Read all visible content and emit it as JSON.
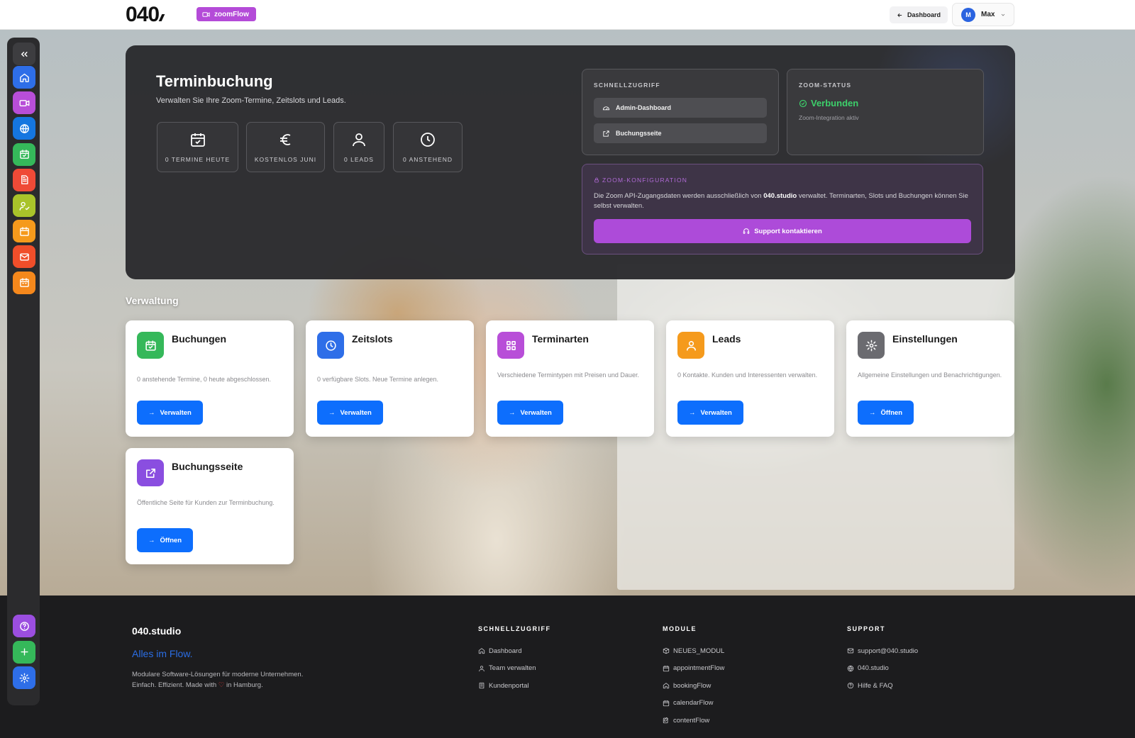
{
  "topbar": {
    "logo": "040",
    "module_label": "zoomFlow",
    "dashboard_label": "Dashboard",
    "user_initial": "M",
    "user_name": "Max"
  },
  "sidebar": {
    "collapse_icon": "chevrons-left-icon",
    "items": [
      {
        "name": "home-icon",
        "color": "#2e6ee8"
      },
      {
        "name": "video-icon",
        "color": "#b84ed8"
      },
      {
        "name": "globe-icon",
        "color": "#1576e0"
      },
      {
        "name": "calendar-check-icon",
        "color": "#35b85a"
      },
      {
        "name": "document-icon",
        "color": "#ef4a37"
      },
      {
        "name": "user-check-icon",
        "color": "#a9c32a"
      },
      {
        "name": "calendar-icon",
        "color": "#f59a1c"
      },
      {
        "name": "mail-icon",
        "color": "#f04e2a"
      },
      {
        "name": "calendar-alt-icon",
        "color": "#f5881c"
      }
    ],
    "bottom": [
      {
        "name": "help-icon",
        "color": "#9b4ee0"
      },
      {
        "name": "plus-icon",
        "color": "#35b85a"
      },
      {
        "name": "settings-icon",
        "color": "#2e6ee8"
      }
    ]
  },
  "hero": {
    "title": "Terminbuchung",
    "subtitle": "Verwalten Sie Ihre Zoom-Termine, Zeitslots und Leads.",
    "stats": [
      {
        "icon": "calendar-check-icon",
        "label": "0 TERMINE HEUTE"
      },
      {
        "icon": "euro-icon",
        "label": "KOSTENLOS JUNI"
      },
      {
        "icon": "user-icon",
        "label": "0 LEADS"
      },
      {
        "icon": "clock-icon",
        "label": "0 ANSTEHEND"
      }
    ],
    "quick": {
      "label": "SCHNELLZUGRIFF",
      "items": [
        "Admin-Dashboard",
        "Buchungsseite"
      ]
    },
    "zoom_status": {
      "label": "ZOOM-STATUS",
      "value": "Verbunden",
      "note": "Zoom-Integration aktiv"
    },
    "zoom_config": {
      "label": "ZOOM-KONFIGURATION",
      "text_before": "Die Zoom API-Zugangsdaten werden ausschließlich von ",
      "text_bold": "040.studio",
      "text_after": " verwaltet. Terminarten, Slots und Buchungen können Sie selbst verwalten.",
      "button": "Support kontaktieren"
    }
  },
  "verwaltung": {
    "title": "Verwaltung",
    "cards": [
      {
        "title": "Buchungen",
        "desc": "0 anstehende Termine, 0 heute abgeschlossen.",
        "button": "Verwalten",
        "color": "#35b85a"
      },
      {
        "title": "Zeitslots",
        "desc": "0 verfügbare Slots. Neue Termine anlegen.",
        "button": "Verwalten",
        "color": "#2e6ee8"
      },
      {
        "title": "Terminarten",
        "desc": "Verschiedene Termintypen mit Preisen und Dauer.",
        "button": "Verwalten",
        "color": "#b84ed8"
      },
      {
        "title": "Leads",
        "desc": "0 Kontakte. Kunden und Interessenten verwalten.",
        "button": "Verwalten",
        "color": "#f59a1c"
      },
      {
        "title": "Einstellungen",
        "desc": "Allgemeine Einstellungen und Benachrichtigungen.",
        "button": "Öffnen",
        "color": "#6b6b70"
      },
      {
        "title": "Buchungsseite",
        "desc": "Öffentliche Seite für Kunden zur Terminbuchung.",
        "button": "Öffnen",
        "color": "#8a4ee0"
      }
    ]
  },
  "footer": {
    "brand": "040.studio",
    "slogan": "Alles im Flow.",
    "desc_line1": "Modulare Software-Lösungen für moderne Unternehmen.",
    "desc_line2_before": "Einfach. Effizient. Made with ",
    "desc_line2_after": " in Hamburg.",
    "columns": [
      {
        "title": "SCHNELLZUGRIFF",
        "links": [
          {
            "icon": "home-icon",
            "label": "Dashboard"
          },
          {
            "icon": "user-icon",
            "label": "Team verwalten"
          },
          {
            "icon": "building-icon",
            "label": "Kundenportal"
          }
        ]
      },
      {
        "title": "MODULE",
        "links": [
          {
            "icon": "box-icon",
            "label": "NEUES_MODUL"
          },
          {
            "icon": "calendar-icon",
            "label": "appointmentFlow"
          },
          {
            "icon": "home-icon",
            "label": "bookingFlow"
          },
          {
            "icon": "calendar-icon",
            "label": "calendarFlow"
          },
          {
            "icon": "edit-icon",
            "label": "contentFlow"
          }
        ]
      },
      {
        "title": "SUPPORT",
        "links": [
          {
            "icon": "mail-icon",
            "label": "support@040.studio"
          },
          {
            "icon": "globe-icon",
            "label": "040.studio"
          },
          {
            "icon": "help-icon",
            "label": "Hilfe & FAQ"
          }
        ]
      }
    ]
  }
}
